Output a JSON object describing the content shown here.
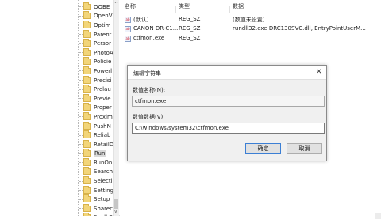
{
  "tree": {
    "items": [
      {
        "label": "OOBE"
      },
      {
        "label": "OpenV"
      },
      {
        "label": "Optim"
      },
      {
        "label": "Parent"
      },
      {
        "label": "Persor"
      },
      {
        "label": "PhotoA"
      },
      {
        "label": "Policie"
      },
      {
        "label": "Powerl"
      },
      {
        "label": "Precisi"
      },
      {
        "label": "Prelau"
      },
      {
        "label": "Previe"
      },
      {
        "label": "Proper"
      },
      {
        "label": "Proxim"
      },
      {
        "label": "PushN"
      },
      {
        "label": "Reliab"
      },
      {
        "label": "RetailD"
      },
      {
        "label": "Run"
      },
      {
        "label": "RunOn"
      },
      {
        "label": "Search"
      },
      {
        "label": "Selecti"
      },
      {
        "label": "Setting"
      },
      {
        "label": "Setup"
      },
      {
        "label": "Sharec"
      },
      {
        "label": "Shell E"
      }
    ],
    "selected_index": 16,
    "scroll_up_glyph": "^",
    "scroll_down_glyph": "v"
  },
  "list": {
    "columns": {
      "name": "名称",
      "type": "类型",
      "data": "数据"
    },
    "rows": [
      {
        "name": "(默认)",
        "type": "REG_SZ",
        "data": "(数值未设置)",
        "icon": "ab"
      },
      {
        "name": "CANON DR-C1...",
        "type": "REG_SZ",
        "data": "rundll32.exe DRC130SVC.dll, EntryPointUserM...",
        "icon": "ab"
      },
      {
        "name": "ctfmon.exe",
        "type": "REG_SZ",
        "data": "",
        "icon": "ab"
      }
    ]
  },
  "dialog": {
    "title": "编辑字符串",
    "close_glyph": "×",
    "name_label": "数值名称(N):",
    "name_value": "ctfmon.exe",
    "data_label": "数值数据(V):",
    "data_value": "C:\\windows\\system32\\ctfmon.exe",
    "ok_label": "确定",
    "cancel_label": "取消"
  },
  "colors": {
    "folder": "#f2d57a",
    "default_button_border": "#3c7fd4"
  }
}
